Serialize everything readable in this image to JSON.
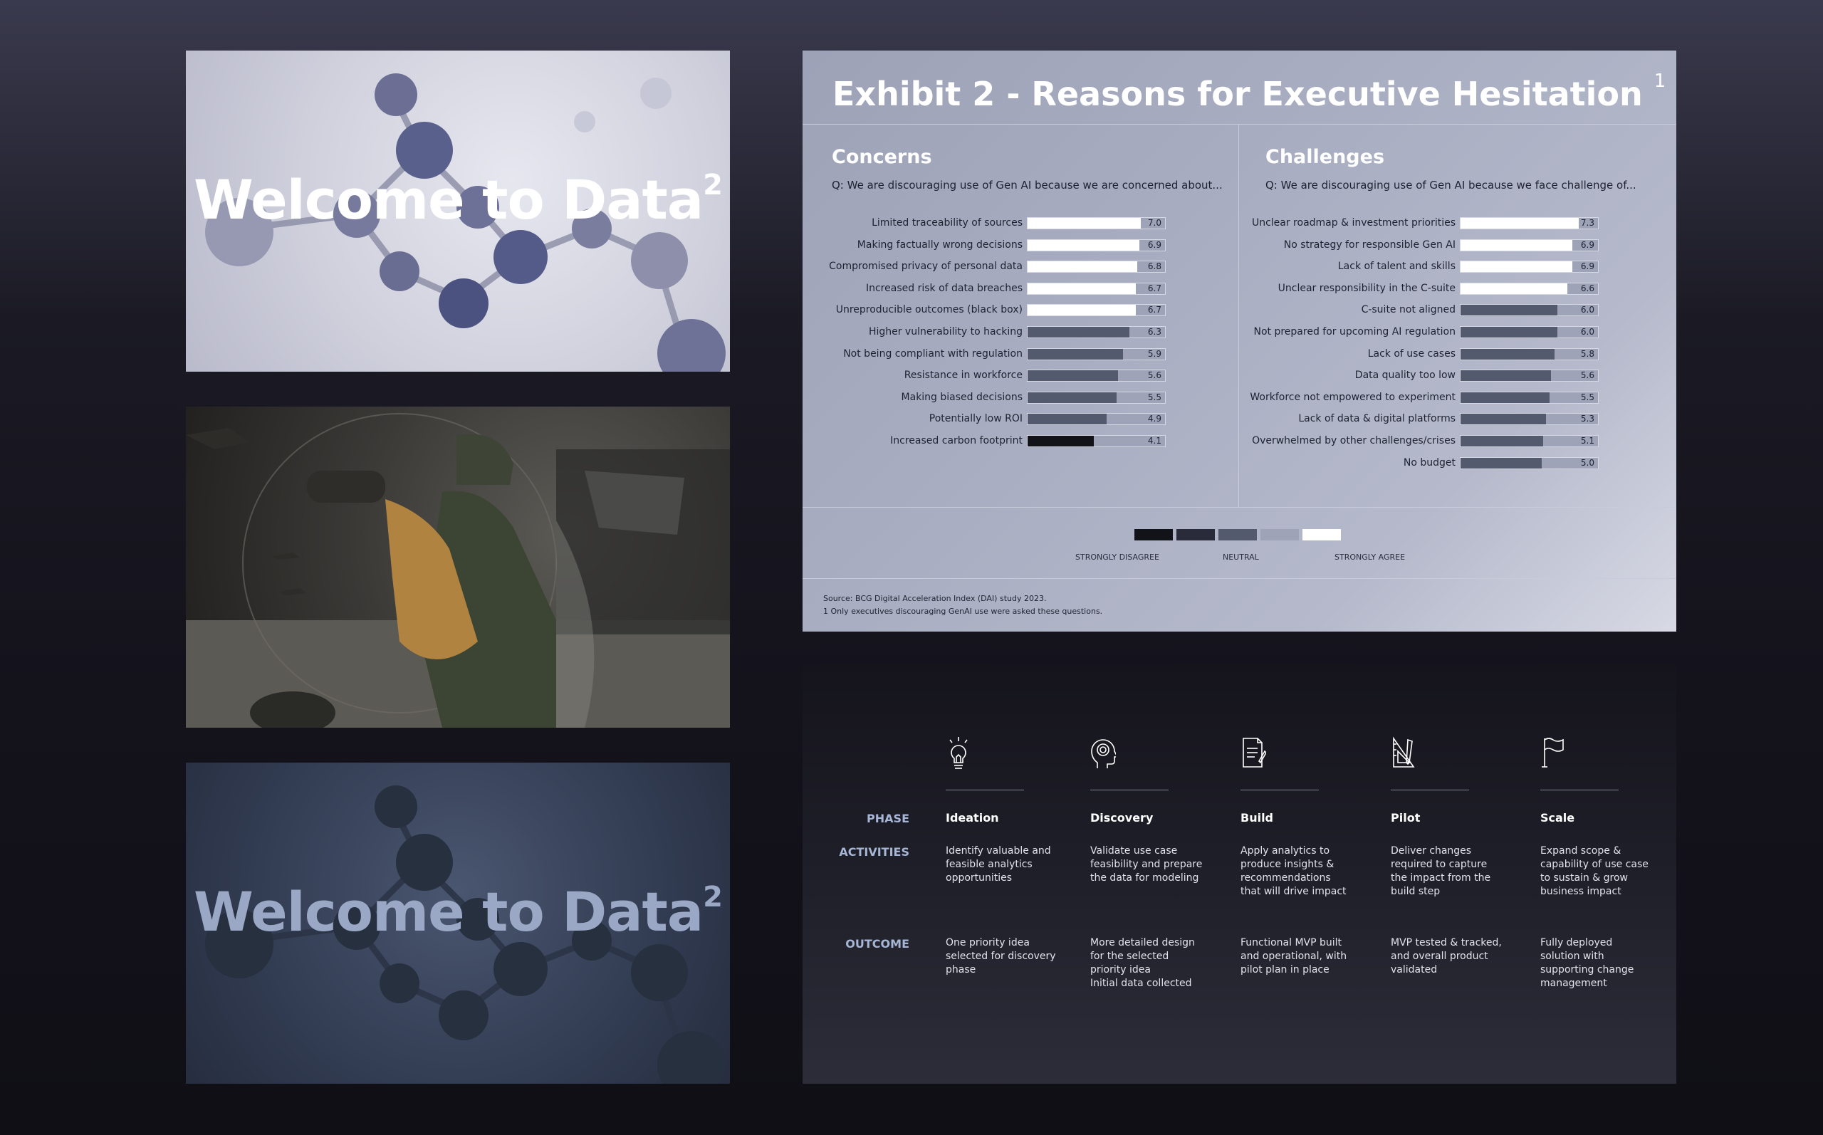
{
  "thumbnails": {
    "first": {
      "title": "Welcome to Data",
      "sup": "2"
    },
    "third": {
      "title": "Welcome to Data",
      "sup": "2"
    }
  },
  "exhibit": {
    "title": "Exhibit 2 - Reasons for Executive Hesitation",
    "title_sup": "1",
    "concerns": {
      "heading": "Concerns",
      "question": "Q: We are discouraging use of Gen AI because we are concerned about...",
      "items": [
        {
          "label": "Limited traceability of sources",
          "value": "7.0",
          "level": "strongly-agree"
        },
        {
          "label": "Making factually wrong decisions",
          "value": "6.9",
          "level": "strongly-agree"
        },
        {
          "label": "Compromised privacy of personal data",
          "value": "6.8",
          "level": "strongly-agree"
        },
        {
          "label": "Increased risk of data breaches",
          "value": "6.7",
          "level": "strongly-agree"
        },
        {
          "label": "Unreproducible outcomes (black box)",
          "value": "6.7",
          "level": "strongly-agree"
        },
        {
          "label": "Higher vulnerability to hacking",
          "value": "6.3",
          "level": "neutral"
        },
        {
          "label": "Not being compliant with regulation",
          "value": "5.9",
          "level": "neutral"
        },
        {
          "label": "Resistance in workforce",
          "value": "5.6",
          "level": "neutral"
        },
        {
          "label": "Making biased decisions",
          "value": "5.5",
          "level": "neutral"
        },
        {
          "label": "Potentially low ROI",
          "value": "4.9",
          "level": "neutral"
        },
        {
          "label": "Increased carbon footprint",
          "value": "4.1",
          "level": "strongly-disagree"
        }
      ]
    },
    "challenges": {
      "heading": "Challenges",
      "question": "Q: We are discouraging use of Gen AI because we face challenge of...",
      "items": [
        {
          "label": "Unclear roadmap & investment priorities",
          "value": "7.3",
          "level": "strongly-agree"
        },
        {
          "label": "No strategy for responsible Gen AI",
          "value": "6.9",
          "level": "strongly-agree"
        },
        {
          "label": "Lack of talent and skills",
          "value": "6.9",
          "level": "strongly-agree"
        },
        {
          "label": "Unclear responsibility in the C-suite",
          "value": "6.6",
          "level": "strongly-agree"
        },
        {
          "label": "C-suite not aligned",
          "value": "6.0",
          "level": "neutral"
        },
        {
          "label": "Not prepared for upcoming AI regulation",
          "value": "6.0",
          "level": "neutral"
        },
        {
          "label": "Lack of use cases",
          "value": "5.8",
          "level": "neutral"
        },
        {
          "label": "Data quality too low",
          "value": "5.6",
          "level": "neutral"
        },
        {
          "label": "Workforce not empowered to experiment",
          "value": "5.5",
          "level": "neutral"
        },
        {
          "label": "Lack of data & digital platforms",
          "value": "5.3",
          "level": "neutral"
        },
        {
          "label": "Overwhelmed by other challenges/crises",
          "value": "5.1",
          "level": "neutral"
        },
        {
          "label": "No budget",
          "value": "5.0",
          "level": "neutral"
        }
      ]
    },
    "scale_max": 8.5,
    "level_colors": {
      "strongly-agree": "#ffffff",
      "neutral": "#545a6e",
      "strongly-disagree": "#121219"
    },
    "legend": {
      "swatches": [
        "#121219",
        "#2a2b3a",
        "#545a6e",
        "#9ea3b8",
        "#ffffff"
      ],
      "left": "STRONGLY DISAGREE",
      "middle": "NEUTRAL",
      "right": "STRONGLY AGREE"
    },
    "source": "Source: BCG Digital Acceleration Index (DAI) study 2023.",
    "footnote": "1 Only executives discouraging GenAI use were asked these questions."
  },
  "phases": {
    "row_labels": {
      "phase": "PHASE",
      "activities": "ACTIVITIES",
      "outcome": "OUTCOME"
    },
    "items": [
      {
        "icon": "lightbulb-icon",
        "name": "Ideation",
        "activities": "Identify valuable and\nfeasible analytics\nopportunities",
        "outcome": "One priority idea\nselected for discovery\nphase"
      },
      {
        "icon": "head-spiral-icon",
        "name": "Discovery",
        "activities": "Validate use case\nfeasibility and prepare\nthe data for modeling",
        "outcome": "More detailed design\nfor the selected\npriority idea\nInitial data collected"
      },
      {
        "icon": "document-pen-icon",
        "name": "Build",
        "activities": "Apply analytics to\nproduce insights &\nrecommendations\nthat will drive impact",
        "outcome": "Functional MVP built\nand operational, with\npilot plan in place"
      },
      {
        "icon": "ruler-pencil-icon",
        "name": "Pilot",
        "activities": "Deliver changes\nrequired to capture\nthe impact from the\nbuild step",
        "outcome": "MVP tested & tracked,\nand overall product\nvalidated"
      },
      {
        "icon": "flag-icon",
        "name": "Scale",
        "activities": "Expand scope &\ncapability of use case\nto sustain & grow\nbusiness impact",
        "outcome": "Fully deployed\nsolution with\nsupporting change\nmanagement"
      }
    ]
  }
}
